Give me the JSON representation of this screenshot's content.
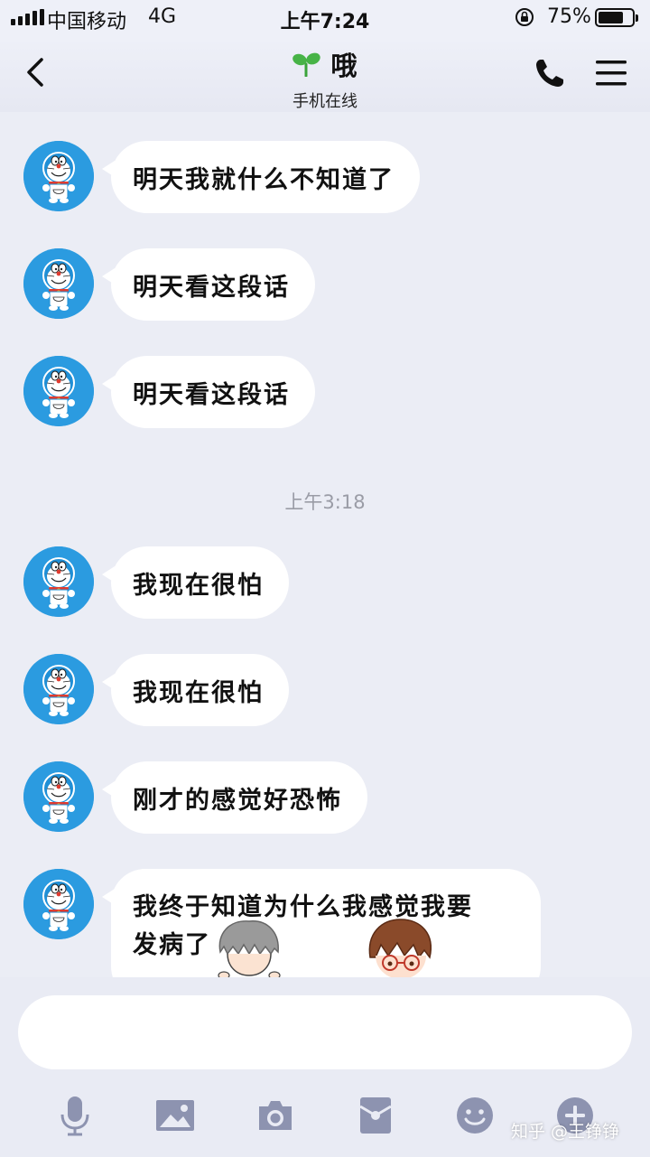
{
  "status_bar": {
    "carrier": "中国移动",
    "network": "4G",
    "time": "上午7:24",
    "battery": "75%",
    "battery_level": 0.75
  },
  "header": {
    "title": "哦",
    "subtitle": "手机在线"
  },
  "messages": [
    {
      "text": "明天我就什么不知道了"
    },
    {
      "text": "明天看这段话"
    },
    {
      "text": "明天看这段话"
    },
    {
      "text": "我现在很怕"
    },
    {
      "text": "我现在很怕"
    },
    {
      "text": "刚才的感觉好恐怖"
    },
    {
      "text_line1": "我终于知道为什么我感觉我要",
      "text_line2": "发病了"
    }
  ],
  "timestamp": "上午3:18",
  "composer": {
    "placeholder": ""
  },
  "watermark": "知乎 @王铮铮",
  "colors": {
    "background": "#ebedf5",
    "bubble": "#ffffff",
    "avatar": "#2b9be0",
    "toolbar_icon": "#8d93b0"
  }
}
